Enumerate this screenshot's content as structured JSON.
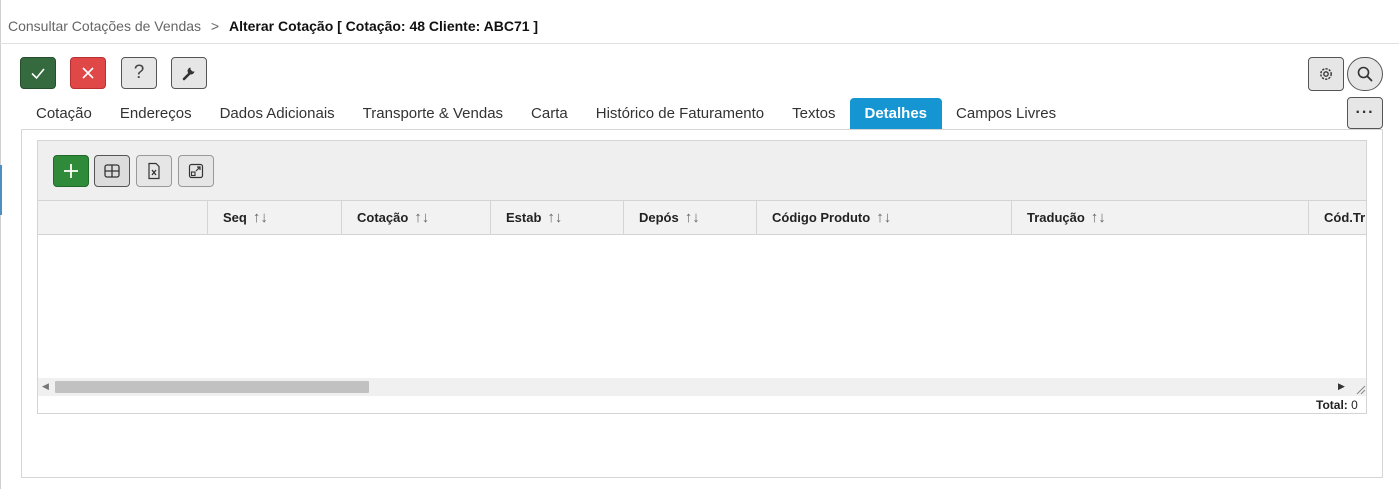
{
  "breadcrumb": {
    "parent": "Consultar Cotações de Vendas",
    "separator": ">",
    "current": "Alterar Cotação [ Cotação: 48 Cliente: ABC71 ]"
  },
  "toolbar": {
    "confirm": "check-icon",
    "cancel": "close-icon",
    "help_label": "?",
    "tools": "wrench-icon",
    "settings": "gear-icon",
    "search": "search-icon",
    "more_label": "···"
  },
  "tabs": [
    {
      "label": "Cotação"
    },
    {
      "label": "Endereços"
    },
    {
      "label": "Dados Adicionais"
    },
    {
      "label": "Transporte & Vendas"
    },
    {
      "label": "Carta"
    },
    {
      "label": "Histórico de Faturamento"
    },
    {
      "label": "Textos"
    },
    {
      "label": "Detalhes",
      "active": true
    },
    {
      "label": "Campos Livres"
    }
  ],
  "grid": {
    "columns": [
      {
        "label": ""
      },
      {
        "label": "Seq"
      },
      {
        "label": "Cotação"
      },
      {
        "label": "Estab"
      },
      {
        "label": "Depós"
      },
      {
        "label": "Código Produto"
      },
      {
        "label": "Tradução"
      },
      {
        "label": "Cód.Tri"
      }
    ],
    "sort_glyph": "↑↓",
    "rows": [],
    "total_label": "Total:",
    "total_value": "0"
  },
  "colors": {
    "active_tab": "#1596d2",
    "confirm": "#356a3e",
    "cancel": "#e04848",
    "add": "#2f8a3a"
  }
}
